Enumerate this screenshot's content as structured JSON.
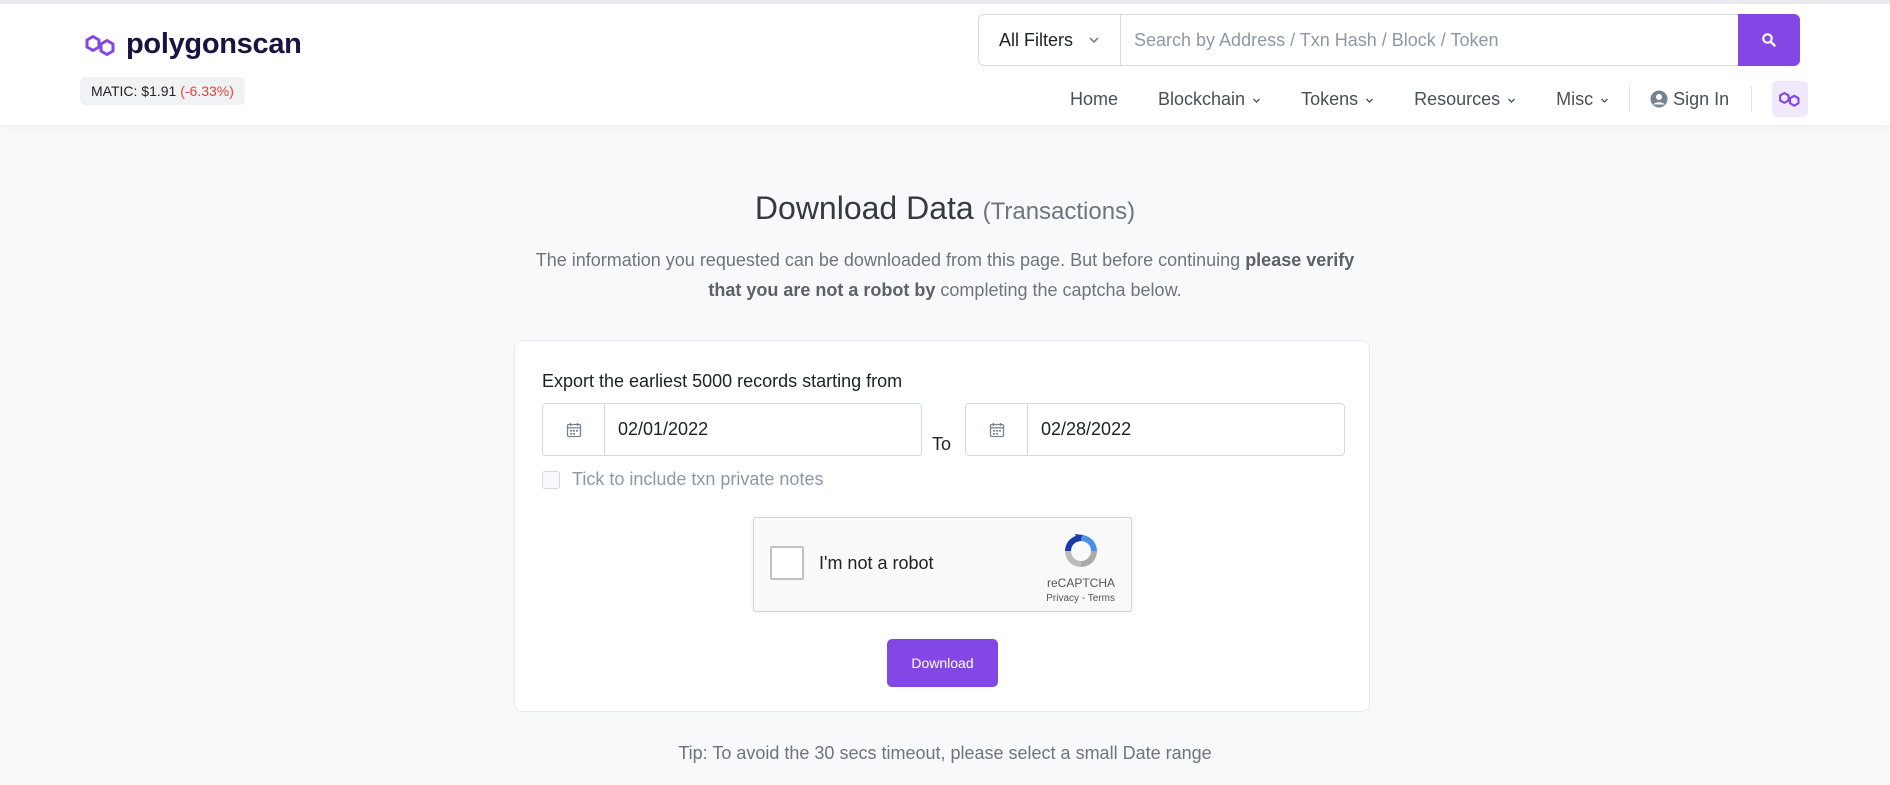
{
  "header": {
    "logo_text": "polygonscan",
    "price_label": "MATIC: $1.91",
    "price_change": "(-6.33%)",
    "filter_label": "All Filters",
    "search_placeholder": "Search by Address / Txn Hash / Block / Token",
    "nav": {
      "home": "Home",
      "blockchain": "Blockchain",
      "tokens": "Tokens",
      "resources": "Resources",
      "misc": "Misc",
      "signin": "Sign In"
    }
  },
  "page": {
    "title": "Download Data",
    "title_sub": "(Transactions)",
    "desc_part1": "The information you requested can be downloaded from this page. But before continuing ",
    "desc_bold": "please verify that you are not a robot by",
    "desc_part2": " completing the captcha below."
  },
  "form": {
    "label": "Export the earliest 5000 records starting from",
    "start_date": "02/01/2022",
    "to_label": "To",
    "end_date": "02/28/2022",
    "checkbox_label": "Tick to include txn private notes",
    "captcha_label": "I'm not a robot",
    "captcha_brand": "reCAPTCHA",
    "captcha_privacy": "Privacy",
    "captcha_sep": " - ",
    "captcha_terms": "Terms",
    "download_label": "Download"
  },
  "tip": "Tip: To avoid the 30 secs timeout, please select a small Date range",
  "colors": {
    "accent": "#8247e5",
    "negative": "#de4437"
  }
}
